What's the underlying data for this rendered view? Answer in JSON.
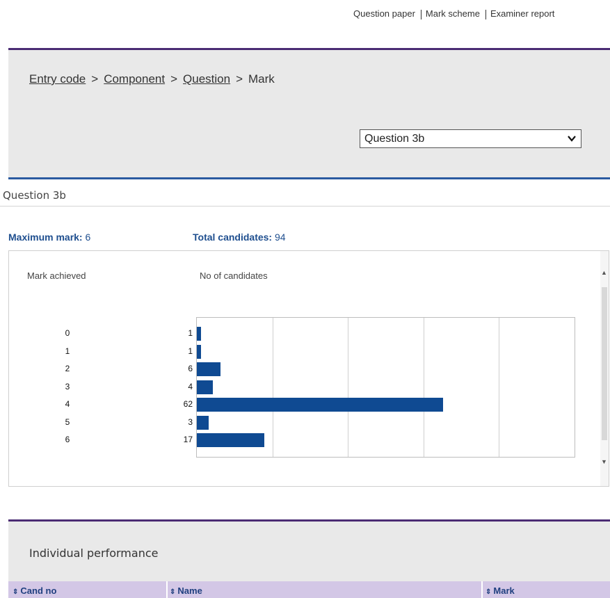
{
  "toplinks": {
    "question_paper": "Question paper",
    "mark_scheme": "Mark scheme",
    "examiner_report": "Examiner report"
  },
  "breadcrumb": {
    "entry_code": "Entry code",
    "component": "Component",
    "question": "Question",
    "mark": "Mark",
    "separator": ">"
  },
  "question_select": {
    "value": "Question 3b"
  },
  "question_title": "Question 3b",
  "stats": {
    "max_label": "Maximum mark:",
    "max_value": "6",
    "total_label": "Total candidates:",
    "total_value": "94"
  },
  "chart_headers": {
    "mark": "Mark achieved",
    "count": "No of candidates"
  },
  "chart_data": {
    "type": "bar",
    "orientation": "horizontal",
    "categories": [
      "0",
      "1",
      "2",
      "3",
      "4",
      "5",
      "6"
    ],
    "values": [
      1,
      1,
      6,
      4,
      62,
      3,
      17
    ],
    "xlim": [
      0,
      95
    ],
    "gridlines": 5,
    "bar_color": "#0f4a92"
  },
  "perf": {
    "title": "Individual performance"
  },
  "table": {
    "columns": [
      "Cand no",
      "Name",
      "Mark"
    ],
    "sort_icon": "⇕"
  },
  "colors": {
    "accent_purple": "#4b2c74",
    "accent_blue": "#2a5aa0",
    "header_lilac": "#d3c7e6",
    "stat_blue": "#1f4f8f"
  }
}
